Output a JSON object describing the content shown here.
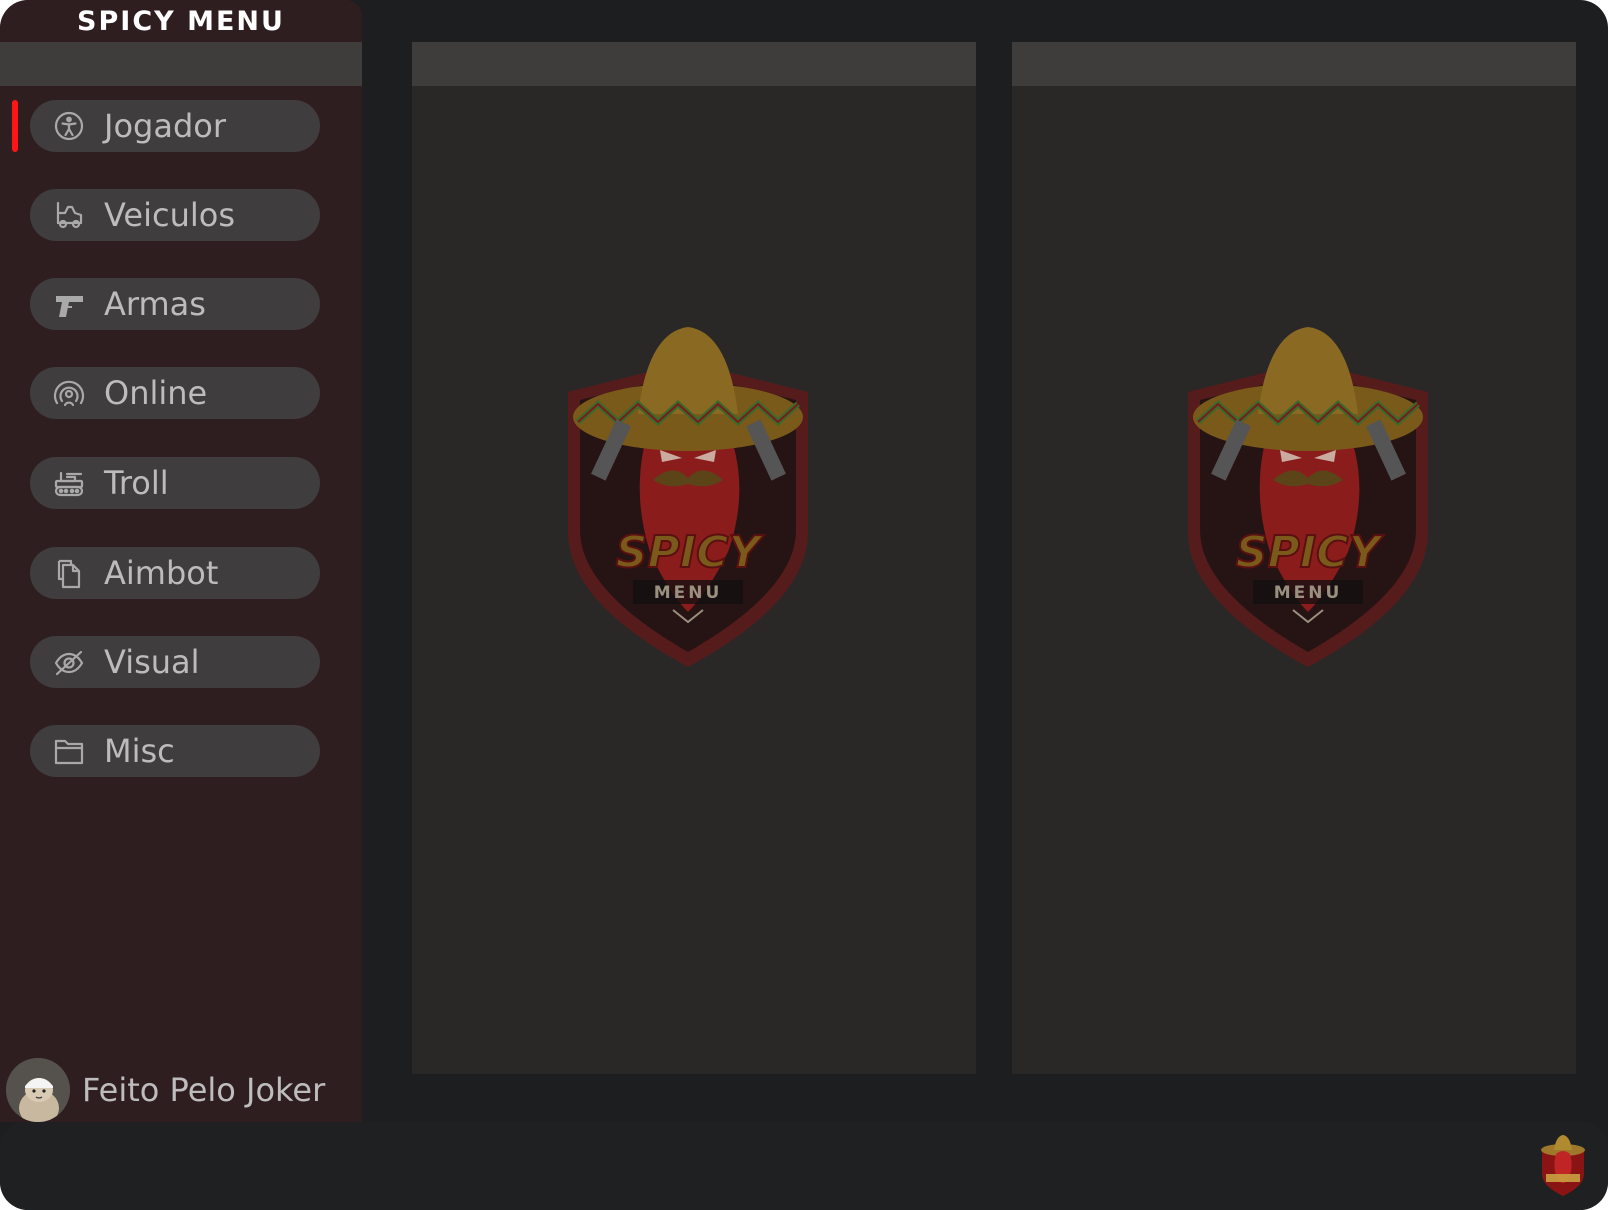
{
  "app": {
    "title": "SPICY MENU"
  },
  "sidebar": {
    "items": [
      {
        "label": "Jogador",
        "icon": "accessibility-icon",
        "active": true
      },
      {
        "label": "Veiculos",
        "icon": "vehicle-icon",
        "active": false
      },
      {
        "label": "Armas",
        "icon": "gun-icon",
        "active": false
      },
      {
        "label": "Online",
        "icon": "broadcast-icon",
        "active": false
      },
      {
        "label": "Troll",
        "icon": "tank-icon",
        "active": false
      },
      {
        "label": "Aimbot",
        "icon": "copy-icon",
        "active": false
      },
      {
        "label": "Visual",
        "icon": "eye-off-icon",
        "active": false
      },
      {
        "label": "Misc",
        "icon": "folder-icon",
        "active": false
      }
    ],
    "footer": {
      "credit": "Feito Pelo Joker"
    }
  },
  "panels": [
    {
      "logo": {
        "word": "SPICY",
        "sub": "MENU"
      }
    },
    {
      "logo": {
        "word": "SPICY",
        "sub": "MENU"
      }
    }
  ],
  "colors": {
    "accent": "#ff1515",
    "sidebar_bg": "#2f1e20",
    "panel_bg": "#2a2727",
    "nav_item_bg": "#3f3d3d",
    "window_bg": "#1d1e20"
  }
}
